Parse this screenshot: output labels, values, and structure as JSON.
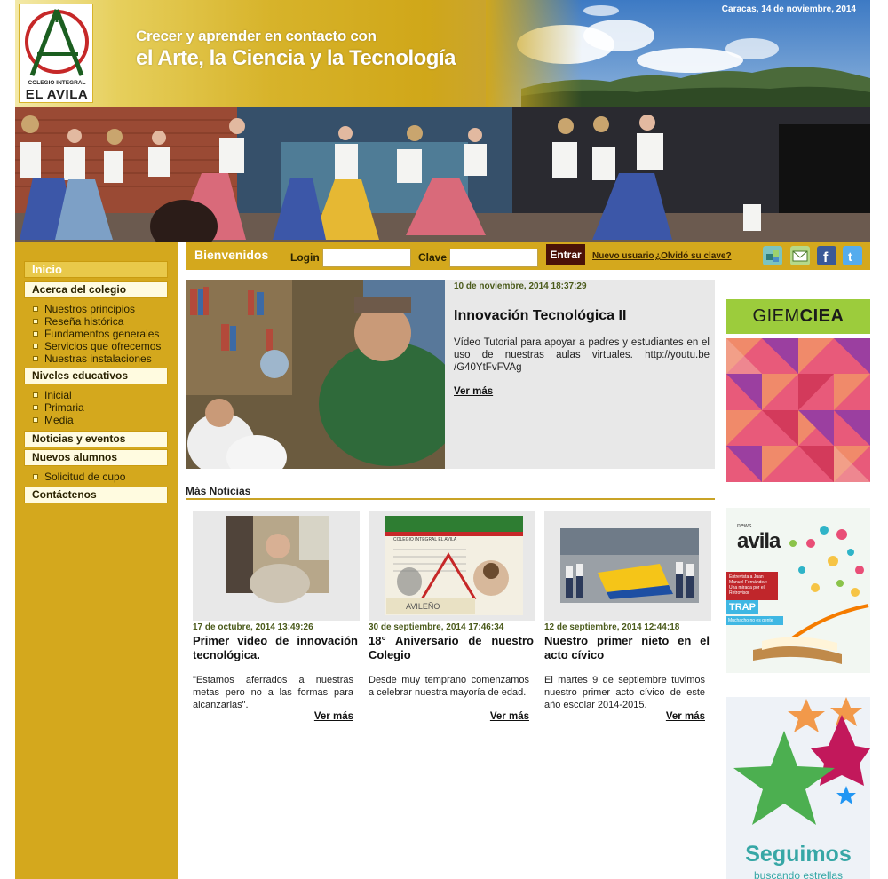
{
  "header": {
    "logo_line1": "COLEGIO INTEGRAL",
    "logo_line2": "EL AVILA",
    "date": "Caracas, 14 de noviembre, 2014",
    "tagline_1": "Crecer y aprender en contacto con",
    "tagline_2": "el Arte, la Ciencia y la Tecnología"
  },
  "sidebar": {
    "home": "Inicio",
    "sections": [
      {
        "label": "Acerca del colegio",
        "items": [
          "Nuestros principios",
          "Reseña histórica",
          "Fundamentos generales",
          "Servicios que ofrecemos",
          "Nuestras instalaciones"
        ]
      },
      {
        "label": "Niveles educativos",
        "items": [
          "Inicial",
          "Primaria",
          "Media"
        ]
      },
      {
        "label": "Noticias y eventos",
        "items": []
      },
      {
        "label": "Nuevos alumnos",
        "items": [
          "Solicitud de cupo"
        ]
      },
      {
        "label": "Contáctenos",
        "items": []
      }
    ]
  },
  "login": {
    "welcome": "Bienvenidos",
    "user_label": "Login",
    "user_value": "",
    "pass_label": "Clave",
    "pass_value": "",
    "submit": "Entrar",
    "new_user": "Nuevo usuario",
    "forgot": "¿Olvidó su clave?",
    "social_icons": [
      "cubes-icon",
      "mail-icon",
      "facebook-icon",
      "twitter-icon"
    ]
  },
  "featured": {
    "date": "10 de noviembre, 2014 18:37:29",
    "title": "Innovación Tecnológica II",
    "description": "Vídeo Tutorial para apoyar a padres y estudiantes en el uso de nuestras aulas virtuales. http://youtu.be /G40YtFvFVAg",
    "more": "Ver más"
  },
  "more_news": {
    "heading": "Más Noticias",
    "items": [
      {
        "date": "17 de octubre, 2014 13:49:26",
        "title": "Primer video de innovación tecnológica.",
        "description": "\"Estamos aferrados a nuestras metas pero no a las formas para alcanzarlas\".",
        "more": "Ver más"
      },
      {
        "date": "30 de septiembre, 2014 17:46:34",
        "title": "18° Aniversario de nuestro Colegio",
        "description": "Desde muy temprano comenzamos a celebrar nuestra mayoría de edad.",
        "more": "Ver más",
        "card_text": {
          "school": "COLEGIO INTEGRAL EL AVILA",
          "word": "AVILEÑO"
        }
      },
      {
        "date": "12 de septiembre, 2014 12:44:18",
        "title": "Nuestro primer nieto en el acto cívico",
        "description": "El martes 9 de septiembre tuvimos nuestro primer acto cívico de este año escolar 2014-2015.",
        "more": "Ver más"
      }
    ]
  },
  "ads": {
    "giem": {
      "title_light": "GIEM",
      "title_bold": "CIEA"
    },
    "newsavila": {
      "label": "news",
      "name": "avila",
      "block": "Entrevista a Juan Manuel Fernández: Una mirada por el Retrovisor",
      "trap": "TRAP",
      "sub": "Muchacho no es gente"
    },
    "stars": {
      "title": "Seguimos",
      "subtitle": "buscando estrellas"
    }
  },
  "colors": {
    "sidebar_gold": "#d4a81d",
    "date_green": "#4a5a1a",
    "entrar_bg": "#4a1208",
    "giem_green": "#9ccc3c",
    "stars_teal": "#37a7a6"
  }
}
